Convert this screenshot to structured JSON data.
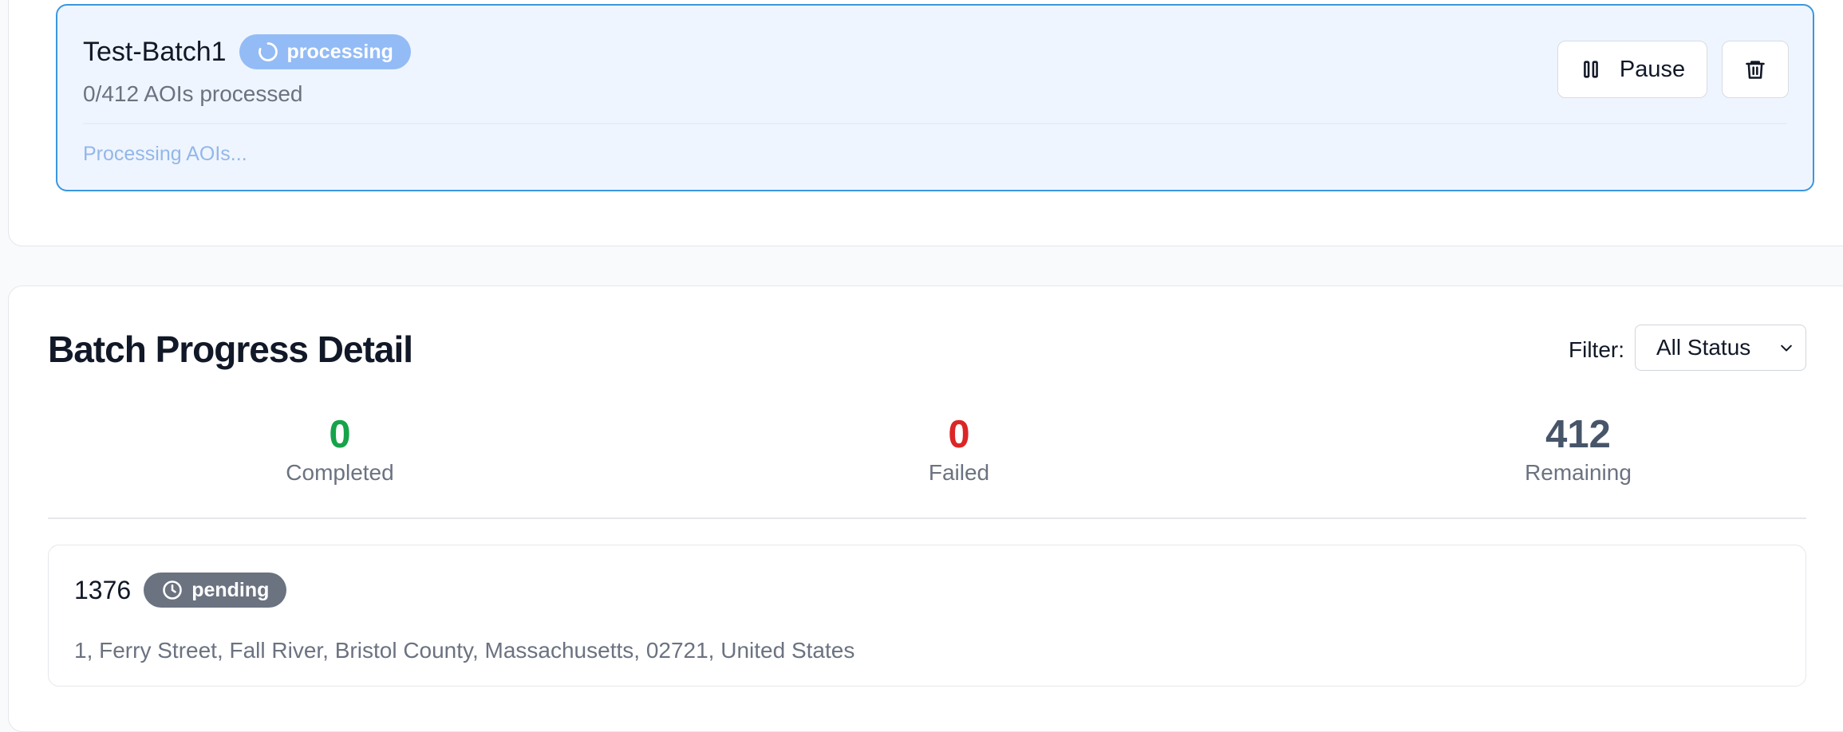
{
  "batch": {
    "name": "Test-Batch1",
    "status_badge": "processing",
    "progress_text": "0/412 AOIs processed",
    "progress_fraction": 0,
    "status_message": "Processing AOIs...",
    "pause_label": "Pause",
    "icons": {
      "status": "spinner-icon",
      "pause": "pause-icon",
      "delete": "trash-icon"
    }
  },
  "detail": {
    "title": "Batch Progress Detail",
    "filter_label": "Filter:",
    "filter_value": "All Status",
    "stats": [
      {
        "value": "0",
        "label": "Completed",
        "color": "#16a34a"
      },
      {
        "value": "0",
        "label": "Failed",
        "color": "#dc2626"
      },
      {
        "value": "412",
        "label": "Remaining",
        "color": "#475569"
      }
    ]
  },
  "aois": [
    {
      "id": "1376",
      "status_badge": "pending",
      "status_icon": "clock-icon",
      "address": "1, Ferry Street, Fall River, Bristol County, Massachusetts, 02721, United States"
    }
  ],
  "colors": {
    "accent": "#3b97e0",
    "processing_badge": "#93bbf6",
    "pending_badge": "#6b7280"
  }
}
